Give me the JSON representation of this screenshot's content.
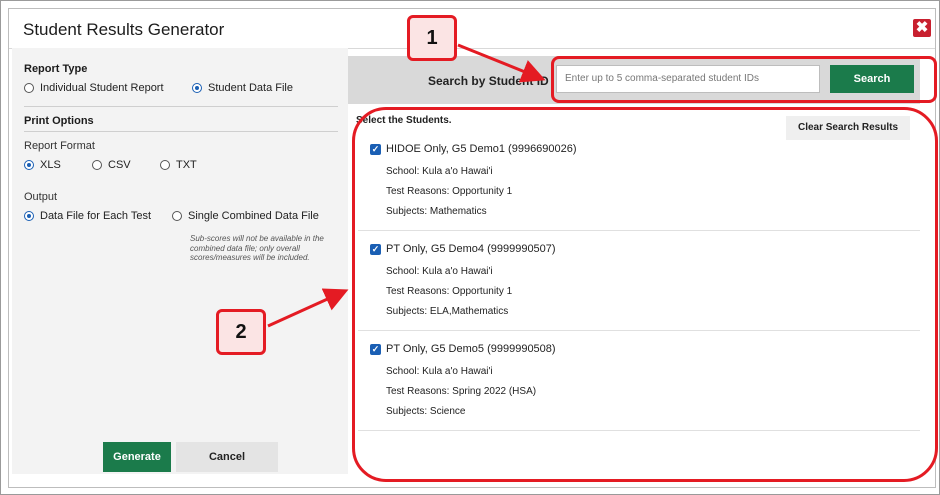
{
  "dialog": {
    "title": "Student Results Generator",
    "close_symbol": "✖"
  },
  "report_type": {
    "title": "Report Type",
    "options": [
      {
        "label": "Individual Student Report",
        "selected": false
      },
      {
        "label": "Student Data File",
        "selected": true
      }
    ]
  },
  "print_options": {
    "title": "Print Options",
    "report_format": {
      "label": "Report Format",
      "options": [
        {
          "label": "XLS",
          "selected": true
        },
        {
          "label": "CSV",
          "selected": false
        },
        {
          "label": "TXT",
          "selected": false
        }
      ]
    },
    "output": {
      "label": "Output",
      "options": [
        {
          "label": "Data File for Each Test",
          "selected": true
        },
        {
          "label": "Single Combined Data File",
          "selected": false
        }
      ],
      "note": "Sub-scores will not be available in the combined data file; only overall scores/measures will be included."
    }
  },
  "actions": {
    "generate": "Generate",
    "cancel": "Cancel"
  },
  "search": {
    "label": "Search by Student ID",
    "placeholder": "Enter up to 5 comma-separated student IDs",
    "button": "Search"
  },
  "results": {
    "title": "Select the Students.",
    "clear_button": "Clear Search Results",
    "students": [
      {
        "name": "HIDOE Only, G5 Demo1 (9996690026)",
        "school": "School: Kula a'o Hawai'i",
        "reasons": "Test Reasons: Opportunity 1",
        "subjects": "Subjects: Mathematics",
        "checked": true
      },
      {
        "name": "PT Only, G5 Demo4 (9999990507)",
        "school": "School: Kula a'o Hawai'i",
        "reasons": "Test Reasons: Opportunity 1",
        "subjects": "Subjects: ELA,Mathematics",
        "checked": true
      },
      {
        "name": "PT Only, G5 Demo5 (9999990508)",
        "school": "School: Kula a'o Hawai'i",
        "reasons": "Test Reasons: Spring 2022 (HSA)",
        "subjects": "Subjects: Science",
        "checked": true
      }
    ]
  },
  "callouts": {
    "one": "1",
    "two": "2"
  },
  "colors": {
    "accent_green": "#1b7b4b",
    "highlight_red": "#e41b23",
    "close_red": "#c8202f",
    "checkbox_blue": "#1a5fb4"
  }
}
